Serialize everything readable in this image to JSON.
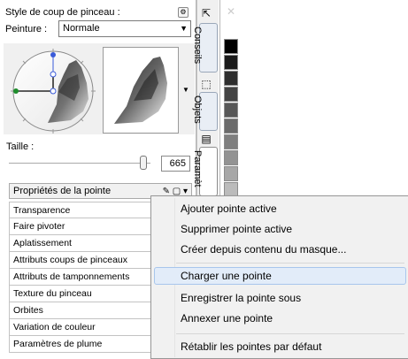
{
  "panel": {
    "brush_style_label": "Style de coup de pinceau :",
    "settings_icon": "gear-icon",
    "paint_label": "Peinture :",
    "paint_mode": "Normale",
    "size_label": "Taille :",
    "size_value": "665",
    "size_slider_fraction": 0.95
  },
  "properties": {
    "header": "Propriétés de la pointe",
    "items": [
      {
        "label": "Transparence"
      },
      {
        "label": "Faire pivoter"
      },
      {
        "label": "Aplatissement"
      },
      {
        "label": "Attributs coups de pinceaux"
      },
      {
        "label": "Attributs de tamponnements"
      },
      {
        "label": "Texture du pinceau"
      },
      {
        "label": "Orbites"
      },
      {
        "label": "Variation de couleur"
      },
      {
        "label": "Paramètres de plume"
      }
    ]
  },
  "tabs": [
    {
      "label": "Conseils"
    },
    {
      "label": "Objets"
    },
    {
      "label": "Paramèt"
    }
  ],
  "swatches": [
    "#000000",
    "#1a1a1a",
    "#2e2e2e",
    "#434343",
    "#575757",
    "#6b6b6b",
    "#7f7f7f",
    "#939393",
    "#a7a7a7",
    "#bbbbbb",
    "#cfcfcf",
    "#e3e3e3"
  ],
  "menu": {
    "items": [
      {
        "label": "Ajouter pointe active"
      },
      {
        "label": "Supprimer pointe active"
      },
      {
        "label": "Créer depuis contenu du masque..."
      },
      {
        "label": "Charger une pointe"
      },
      {
        "label": "Enregistrer la pointe sous"
      },
      {
        "label": "Annexer une pointe"
      },
      {
        "label": "Rétablir les pointes par défaut"
      }
    ],
    "highlighted_index": 3
  }
}
